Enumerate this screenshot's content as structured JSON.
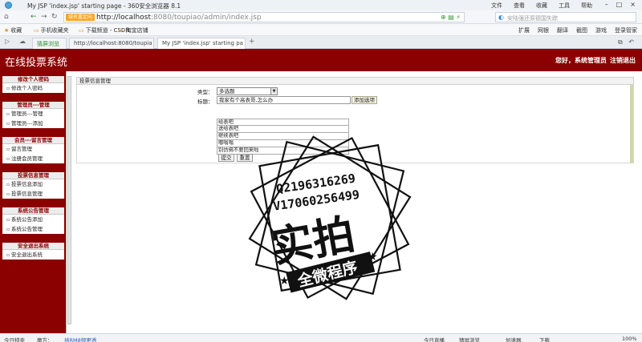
{
  "browser": {
    "window_title": "My JSP 'index.jsp' starting page - 360安全浏览器 8.1",
    "menu": [
      "文件",
      "查看",
      "收藏",
      "工具",
      "帮助"
    ],
    "address_badge": "域名重定向",
    "url_host": "http://localhost",
    "url_rest": ":8080/toupiao/admin/index.jsp",
    "search_placeholder": "安陆强还原德国失踪",
    "favorites": [
      "收藏",
      "手机收藏夹",
      "下载频道 - CSDN...",
      "淘宝店铺"
    ],
    "fav_tools": [
      "扩展",
      "网银",
      "翻译",
      "截图",
      "游戏",
      "登录管家"
    ],
    "tabs": [
      {
        "label": "猜屏浏览"
      },
      {
        "label": "http://localhost:8080/toupia"
      },
      {
        "label": "My JSP 'index.jsp' starting pa"
      }
    ],
    "status": {
      "left1": "今日特卖",
      "left2": "魔方：",
      "left_link": "插RM8频更透",
      "right": [
        "今日直播",
        "猜屏浏览",
        "加速器",
        "下载",
        "100%"
      ]
    }
  },
  "header": {
    "title": "在线投票系统",
    "greeting": "您好，",
    "role": "系统管理员",
    "logout": "注销退出"
  },
  "sidebar": {
    "sections": [
      {
        "title": "修改个人密码",
        "items": [
          "修改个人密码"
        ]
      },
      {
        "title": "管理员---管理",
        "items": [
          "管理员---管理",
          "管理员---添加"
        ]
      },
      {
        "title": "会员---留言管理",
        "items": [
          "留言管理",
          "注册会员管理"
        ]
      },
      {
        "title": "投票信息管理",
        "items": [
          "投票信息添加",
          "投票信息管理"
        ]
      },
      {
        "title": "系统公告管理",
        "items": [
          "系统公告添加",
          "系统公告管理"
        ]
      },
      {
        "title": "安全退出系统",
        "items": [
          "安全退出系统"
        ]
      }
    ]
  },
  "form": {
    "heading": "投票信息管理",
    "type_label": "类型：",
    "type_value": "多选题",
    "title_label": "标题：",
    "title_value": "我家有个高表哥,怎么办",
    "add_option": "添加选项",
    "options": [
      "给表吧",
      "送给表吧",
      "继续表吧",
      "哪嗡嗡",
      "别仿佛不要回来啦"
    ],
    "submit": "提交",
    "reset": "重置"
  },
  "watermark": {
    "line1": "Q2196316269",
    "line2": "V17060256499",
    "main": "实拍",
    "ribbon": "全微程序"
  }
}
